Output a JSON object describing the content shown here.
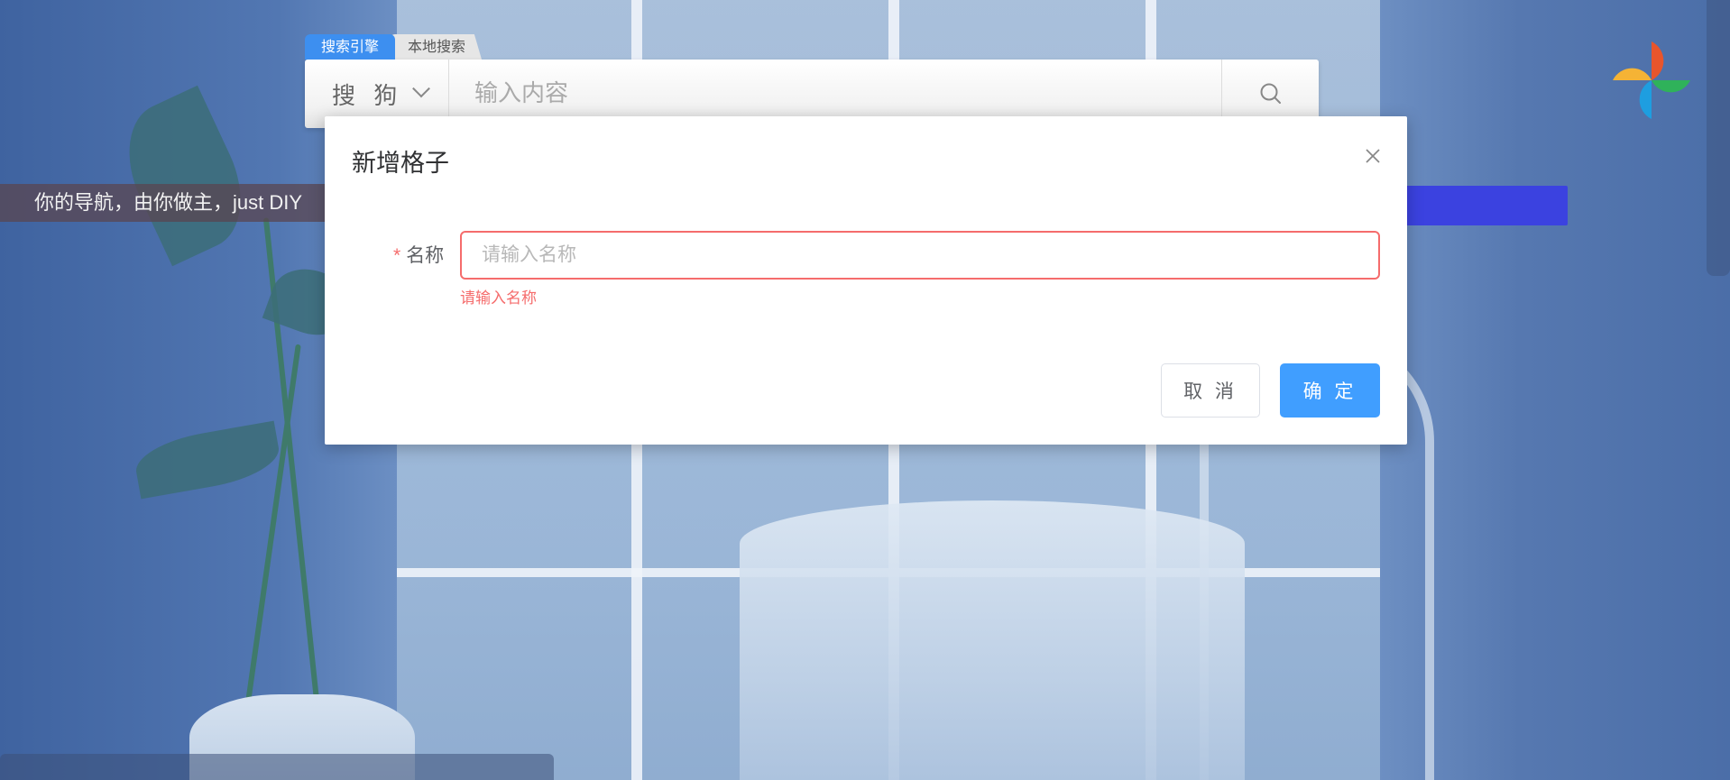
{
  "search": {
    "tabs": [
      {
        "label": "搜索引擎",
        "active": true
      },
      {
        "label": "本地搜索",
        "active": false
      }
    ],
    "engine": "搜 狗",
    "placeholder": "输入内容",
    "icon": "search-icon"
  },
  "nav_banner": {
    "text": "你的导航，由你做主，just DIY"
  },
  "dialog": {
    "title": "新增格子",
    "close_icon": "close-icon",
    "field": {
      "required_mark": "*",
      "label": "名称",
      "placeholder": "请输入名称",
      "value": "",
      "error": "请输入名称"
    },
    "cancel_label": "取 消",
    "confirm_label": "确 定"
  },
  "colors": {
    "primary": "#409eff",
    "error": "#f56c6c",
    "tab_active": "#3d8ff0",
    "accent_bar": "#3b42e0"
  },
  "logo": {
    "icon": "pinwheel-logo-icon"
  }
}
